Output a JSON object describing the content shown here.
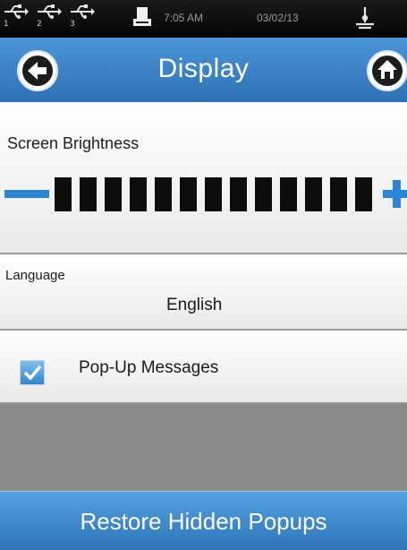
{
  "status_bar": {
    "usb_ports": [
      {
        "icon": "usb-icon",
        "number": "1"
      },
      {
        "icon": "usb-icon",
        "number": "2"
      },
      {
        "icon": "usb-icon",
        "number": "3"
      }
    ],
    "printer_icon": "printer-icon",
    "time": "7:05 AM",
    "date": "03/02/13",
    "power_icon": "power-plug-icon"
  },
  "header": {
    "title": "Display",
    "back_icon": "back-arrow-icon",
    "home_icon": "home-icon"
  },
  "brightness": {
    "label": "Screen Brightness",
    "decrease_icon": "minus-icon",
    "increase_icon": "plus-icon",
    "level": 13,
    "max_level": 13
  },
  "language": {
    "label": "Language",
    "value": "English"
  },
  "popups": {
    "label": "Pop-Up Messages",
    "checked": true
  },
  "restore_button": {
    "label": "Restore Hidden Popups"
  },
  "colors": {
    "accent": "#2a86d4",
    "header": "#3a85c8",
    "status_bar": "#111111"
  }
}
